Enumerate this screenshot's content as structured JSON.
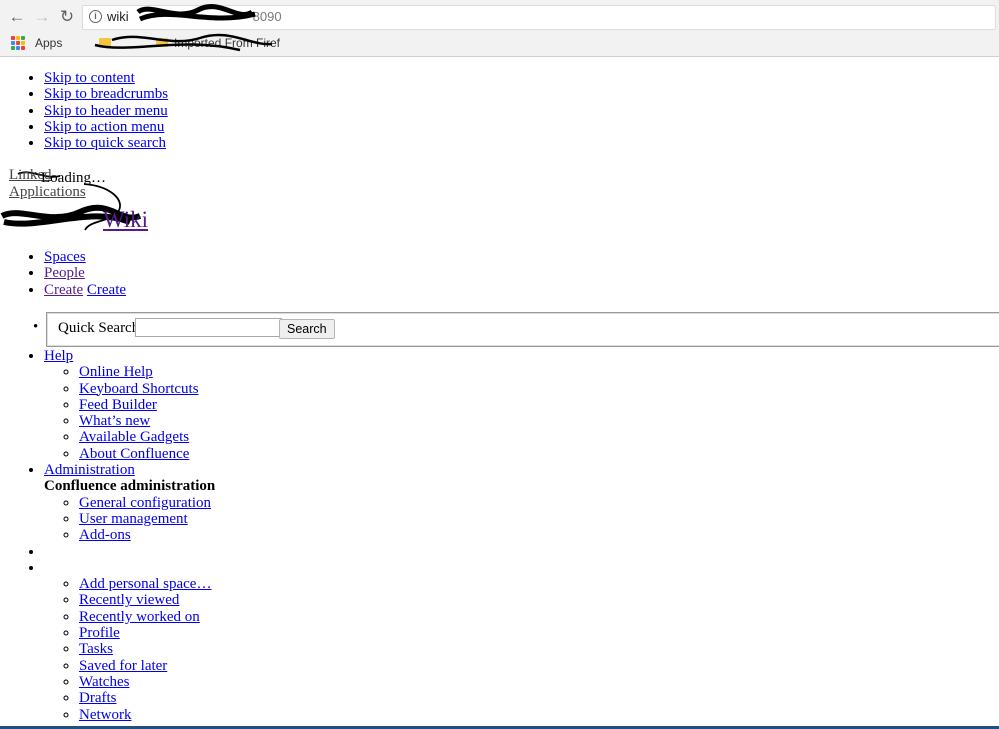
{
  "browser": {
    "url_host": "wiki",
    "url_port": "8090",
    "bookmarks": {
      "apps_label": "Apps",
      "imported_label": "Imported From Firef"
    },
    "apps_colors": [
      "#ea4335",
      "#fbbc05",
      "#34a853",
      "#4285f4",
      "#ea4335",
      "#fbbc05",
      "#34a853",
      "#4285f4",
      "#ea4335"
    ]
  },
  "skip_links": [
    "Skip to content",
    "Skip to breadcrumbs",
    "Skip to header menu",
    "Skip to action menu",
    "Skip to quick search"
  ],
  "header": {
    "linked_applications": [
      "Linked",
      "Applications"
    ],
    "loading_text": "Loading…",
    "site_title": "Wiki"
  },
  "nav": {
    "spaces": "Spaces",
    "people": "People",
    "create_1": "Create",
    "create_2": "Create"
  },
  "search": {
    "label": "Quick Search",
    "input_value": "",
    "button": "Search"
  },
  "help_menu": {
    "title": "Help",
    "items": [
      "Online Help",
      "Keyboard Shortcuts",
      "Feed Builder",
      "What’s new",
      "Available Gadgets",
      "About Confluence"
    ]
  },
  "admin_menu": {
    "title": "Administration",
    "heading": "Confluence administration",
    "items": [
      "General configuration",
      "User management",
      "Add-ons"
    ]
  },
  "user_menu": {
    "items": [
      "Add personal space…",
      "Recently viewed",
      "Recently worked on",
      "Profile",
      "Tasks",
      "Saved for later",
      "Watches",
      "Drafts",
      "Network"
    ]
  },
  "colors": {
    "link": "#0000ee",
    "visited_link": "#551a8b",
    "bottom_bar": "#205081"
  }
}
